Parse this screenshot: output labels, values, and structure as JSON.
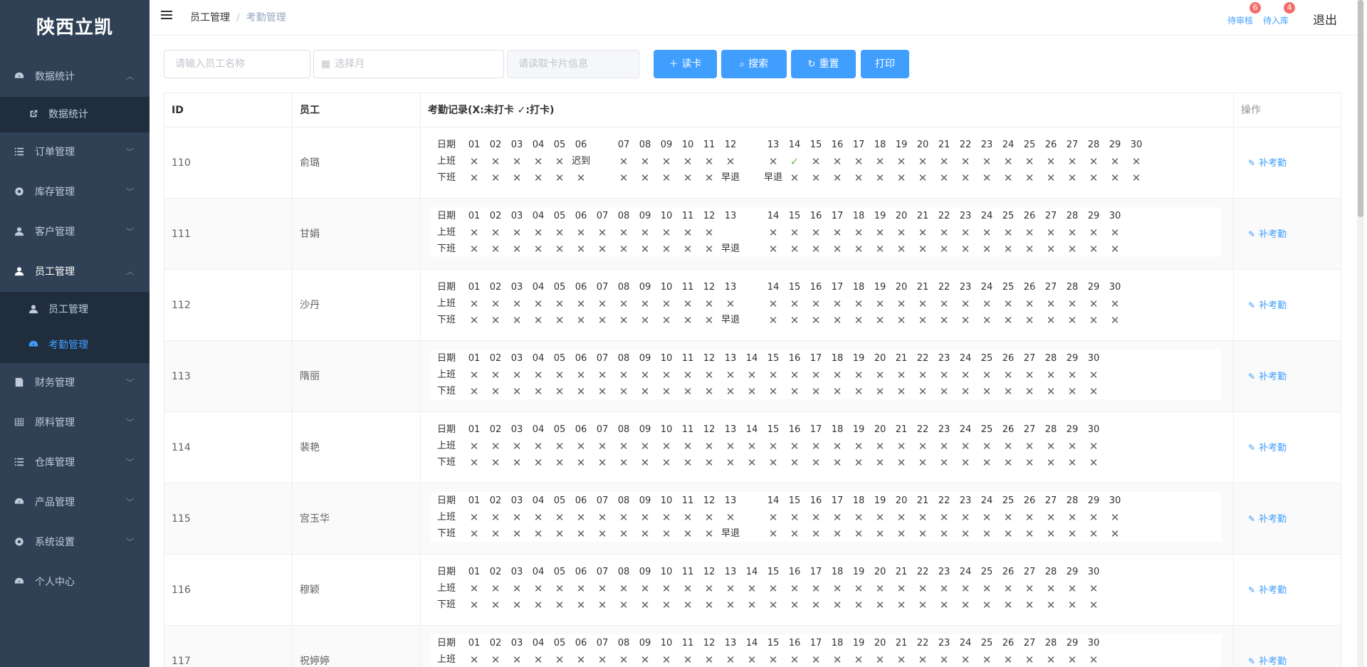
{
  "sidebar": {
    "logo": "陕西立凯",
    "items": [
      {
        "label": "数据统计",
        "icon": "dashboard-icon",
        "arrow": "up"
      },
      {
        "label": "订单管理",
        "icon": "list-icon",
        "arrow": "down"
      },
      {
        "label": "库存管理",
        "icon": "component-icon",
        "arrow": "down"
      },
      {
        "label": "客户管理",
        "icon": "user-icon",
        "arrow": "down"
      },
      {
        "label": "员工管理",
        "icon": "user-icon",
        "arrow": "up"
      },
      {
        "label": "财务管理",
        "icon": "form-icon",
        "arrow": "down"
      },
      {
        "label": "原料管理",
        "icon": "table-icon",
        "arrow": "down"
      },
      {
        "label": "仓库管理",
        "icon": "list-icon",
        "arrow": "down"
      },
      {
        "label": "产品管理",
        "icon": "dashboard-icon",
        "arrow": "down"
      },
      {
        "label": "系统设置",
        "icon": "component-icon",
        "arrow": "down"
      },
      {
        "label": "个人中心",
        "icon": "dashboard-icon",
        "arrow": ""
      }
    ],
    "sub_stats": {
      "label": "数据统计",
      "icon": "external-link-icon"
    },
    "sub_staff": {
      "label": "员工管理",
      "icon": "user-icon"
    },
    "sub_attendance": {
      "label": "考勤管理",
      "icon": "dashboard-icon"
    }
  },
  "navbar": {
    "breadcrumb_home": "员工管理",
    "breadcrumb_sep": "/",
    "breadcrumb_current": "考勤管理",
    "pending_review": {
      "label": "待审核",
      "count": "6"
    },
    "pending_stock": {
      "label": "待入库",
      "count": "4"
    },
    "logout": "退出"
  },
  "filter": {
    "name_placeholder": "请输入员工名称",
    "month_placeholder": "选择月",
    "card_placeholder": "请读取卡片信息",
    "read_card": "读卡",
    "search": "搜索",
    "reset": "重置",
    "print": "打印"
  },
  "table": {
    "headers": {
      "id": "ID",
      "employee": "员工",
      "record": "考勤记录(X:未打卡 ✓:打卡)",
      "action": "操作"
    },
    "row_labels": {
      "date": "日期",
      "on": "上班",
      "off": "下班"
    },
    "action_label": "补考勤",
    "rows": [
      {
        "id": "110",
        "name": "俞璐",
        "days": [
          "01",
          "02",
          "03",
          "04",
          "05",
          "06",
          "",
          "07",
          "08",
          "09",
          "10",
          "11",
          "12",
          "",
          "13",
          "14",
          "15",
          "16",
          "17",
          "18",
          "19",
          "20",
          "21",
          "22",
          "23",
          "24",
          "25",
          "26",
          "27",
          "28",
          "29",
          "30"
        ],
        "on": [
          "✕",
          "✕",
          "✕",
          "✕",
          "✕",
          "迟到",
          "",
          "✕",
          "✕",
          "✕",
          "✕",
          "✕",
          "✕",
          "",
          "✕",
          "✓",
          "✕",
          "✕",
          "✕",
          "✕",
          "✕",
          "✕",
          "✕",
          "✕",
          "✕",
          "✕",
          "✕",
          "✕",
          "✕",
          "✕",
          "✕",
          "✕"
        ],
        "off": [
          "✕",
          "✕",
          "✕",
          "✕",
          "✕",
          "✕",
          "",
          "✕",
          "✕",
          "✕",
          "✕",
          "✕",
          "早退",
          "",
          "早退",
          "✕",
          "✕",
          "✕",
          "✕",
          "✕",
          "✕",
          "✕",
          "✕",
          "✕",
          "✕",
          "✕",
          "✕",
          "✕",
          "✕",
          "✕",
          "✕",
          "✕"
        ]
      },
      {
        "id": "111",
        "name": "甘娟",
        "days": [
          "01",
          "02",
          "03",
          "04",
          "05",
          "06",
          "07",
          "08",
          "09",
          "10",
          "11",
          "12",
          "13",
          "",
          "14",
          "15",
          "16",
          "17",
          "18",
          "19",
          "20",
          "21",
          "22",
          "23",
          "24",
          "25",
          "26",
          "27",
          "28",
          "29",
          "30"
        ],
        "on": [
          "✕",
          "✕",
          "✕",
          "✕",
          "✕",
          "✕",
          "✕",
          "✕",
          "✕",
          "✕",
          "✕",
          "✕",
          "",
          "",
          "✕",
          "✕",
          "✕",
          "✕",
          "✕",
          "✕",
          "✕",
          "✕",
          "✕",
          "✕",
          "✕",
          "✕",
          "✕",
          "✕",
          "✕",
          "✕",
          "✕"
        ],
        "off": [
          "✕",
          "✕",
          "✕",
          "✕",
          "✕",
          "✕",
          "✕",
          "✕",
          "✕",
          "✕",
          "✕",
          "✕",
          "早退",
          "",
          "✕",
          "✕",
          "✕",
          "✕",
          "✕",
          "✕",
          "✕",
          "✕",
          "✕",
          "✕",
          "✕",
          "✕",
          "✕",
          "✕",
          "✕",
          "✕",
          "✕"
        ]
      },
      {
        "id": "112",
        "name": "沙丹",
        "days": [
          "01",
          "02",
          "03",
          "04",
          "05",
          "06",
          "07",
          "08",
          "09",
          "10",
          "11",
          "12",
          "13",
          "",
          "14",
          "15",
          "16",
          "17",
          "18",
          "19",
          "20",
          "21",
          "22",
          "23",
          "24",
          "25",
          "26",
          "27",
          "28",
          "29",
          "30"
        ],
        "on": [
          "✕",
          "✕",
          "✕",
          "✕",
          "✕",
          "✕",
          "✕",
          "✕",
          "✕",
          "✕",
          "✕",
          "✕",
          "✕",
          "",
          "✕",
          "✕",
          "✕",
          "✕",
          "✕",
          "✕",
          "✕",
          "✕",
          "✕",
          "✕",
          "✕",
          "✕",
          "✕",
          "✕",
          "✕",
          "✕",
          "✕"
        ],
        "off": [
          "✕",
          "✕",
          "✕",
          "✕",
          "✕",
          "✕",
          "✕",
          "✕",
          "✕",
          "✕",
          "✕",
          "✕",
          "早退",
          "",
          "✕",
          "✕",
          "✕",
          "✕",
          "✕",
          "✕",
          "✕",
          "✕",
          "✕",
          "✕",
          "✕",
          "✕",
          "✕",
          "✕",
          "✕",
          "✕",
          "✕"
        ]
      },
      {
        "id": "113",
        "name": "隋丽",
        "days": [
          "01",
          "02",
          "03",
          "04",
          "05",
          "06",
          "07",
          "08",
          "09",
          "10",
          "11",
          "12",
          "13",
          "14",
          "15",
          "16",
          "17",
          "18",
          "19",
          "20",
          "21",
          "22",
          "23",
          "24",
          "25",
          "26",
          "27",
          "28",
          "29",
          "30"
        ],
        "on": [
          "✕",
          "✕",
          "✕",
          "✕",
          "✕",
          "✕",
          "✕",
          "✕",
          "✕",
          "✕",
          "✕",
          "✕",
          "✕",
          "✕",
          "✕",
          "✕",
          "✕",
          "✕",
          "✕",
          "✕",
          "✕",
          "✕",
          "✕",
          "✕",
          "✕",
          "✕",
          "✕",
          "✕",
          "✕",
          "✕"
        ],
        "off": [
          "✕",
          "✕",
          "✕",
          "✕",
          "✕",
          "✕",
          "✕",
          "✕",
          "✕",
          "✕",
          "✕",
          "✕",
          "✕",
          "✕",
          "✕",
          "✕",
          "✕",
          "✕",
          "✕",
          "✕",
          "✕",
          "✕",
          "✕",
          "✕",
          "✕",
          "✕",
          "✕",
          "✕",
          "✕",
          "✕"
        ]
      },
      {
        "id": "114",
        "name": "裴艳",
        "days": [
          "01",
          "02",
          "03",
          "04",
          "05",
          "06",
          "07",
          "08",
          "09",
          "10",
          "11",
          "12",
          "13",
          "14",
          "15",
          "16",
          "17",
          "18",
          "19",
          "20",
          "21",
          "22",
          "23",
          "24",
          "25",
          "26",
          "27",
          "28",
          "29",
          "30"
        ],
        "on": [
          "✕",
          "✕",
          "✕",
          "✕",
          "✕",
          "✕",
          "✕",
          "✕",
          "✕",
          "✕",
          "✕",
          "✕",
          "✕",
          "✕",
          "✕",
          "✕",
          "✕",
          "✕",
          "✕",
          "✕",
          "✕",
          "✕",
          "✕",
          "✕",
          "✕",
          "✕",
          "✕",
          "✕",
          "✕",
          "✕"
        ],
        "off": [
          "✕",
          "✕",
          "✕",
          "✕",
          "✕",
          "✕",
          "✕",
          "✕",
          "✕",
          "✕",
          "✕",
          "✕",
          "✕",
          "✕",
          "✕",
          "✕",
          "✕",
          "✕",
          "✕",
          "✕",
          "✕",
          "✕",
          "✕",
          "✕",
          "✕",
          "✕",
          "✕",
          "✕",
          "✕",
          "✕"
        ]
      },
      {
        "id": "115",
        "name": "宫玉华",
        "days": [
          "01",
          "02",
          "03",
          "04",
          "05",
          "06",
          "07",
          "08",
          "09",
          "10",
          "11",
          "12",
          "13",
          "",
          "14",
          "15",
          "16",
          "17",
          "18",
          "19",
          "20",
          "21",
          "22",
          "23",
          "24",
          "25",
          "26",
          "27",
          "28",
          "29",
          "30"
        ],
        "on": [
          "✕",
          "✕",
          "✕",
          "✕",
          "✕",
          "✕",
          "✕",
          "✕",
          "✕",
          "✕",
          "✕",
          "✕",
          "✕",
          "",
          "✕",
          "✕",
          "✕",
          "✕",
          "✕",
          "✕",
          "✕",
          "✕",
          "✕",
          "✕",
          "✕",
          "✕",
          "✕",
          "✕",
          "✕",
          "✕",
          "✕"
        ],
        "off": [
          "✕",
          "✕",
          "✕",
          "✕",
          "✕",
          "✕",
          "✕",
          "✕",
          "✕",
          "✕",
          "✕",
          "✕",
          "早退",
          "",
          "✕",
          "✕",
          "✕",
          "✕",
          "✕",
          "✕",
          "✕",
          "✕",
          "✕",
          "✕",
          "✕",
          "✕",
          "✕",
          "✕",
          "✕",
          "✕",
          "✕"
        ]
      },
      {
        "id": "116",
        "name": "穆颖",
        "days": [
          "01",
          "02",
          "03",
          "04",
          "05",
          "06",
          "07",
          "08",
          "09",
          "10",
          "11",
          "12",
          "13",
          "14",
          "15",
          "16",
          "17",
          "18",
          "19",
          "20",
          "21",
          "22",
          "23",
          "24",
          "25",
          "26",
          "27",
          "28",
          "29",
          "30"
        ],
        "on": [
          "✕",
          "✕",
          "✕",
          "✕",
          "✕",
          "✕",
          "✕",
          "✕",
          "✕",
          "✕",
          "✕",
          "✕",
          "✕",
          "✕",
          "✕",
          "✕",
          "✕",
          "✕",
          "✕",
          "✕",
          "✕",
          "✕",
          "✕",
          "✕",
          "✕",
          "✕",
          "✕",
          "✕",
          "✕",
          "✕"
        ],
        "off": [
          "✕",
          "✕",
          "✕",
          "✕",
          "✕",
          "✕",
          "✕",
          "✕",
          "✕",
          "✕",
          "✕",
          "✕",
          "✕",
          "✕",
          "✕",
          "✕",
          "✕",
          "✕",
          "✕",
          "✕",
          "✕",
          "✕",
          "✕",
          "✕",
          "✕",
          "✕",
          "✕",
          "✕",
          "✕",
          "✕"
        ]
      },
      {
        "id": "117",
        "name": "祝婷婷",
        "days": [
          "01",
          "02",
          "03",
          "04",
          "05",
          "06",
          "07",
          "08",
          "09",
          "10",
          "11",
          "12",
          "13",
          "14",
          "15",
          "16",
          "17",
          "18",
          "19",
          "20",
          "21",
          "22",
          "23",
          "24",
          "25",
          "26",
          "27",
          "28",
          "29",
          "30"
        ],
        "on": [
          "✕",
          "✕",
          "✕",
          "✕",
          "✕",
          "✕",
          "✕",
          "✕",
          "✕",
          "✕",
          "✕",
          "✕",
          "✕",
          "✕",
          "✕",
          "✕",
          "✕",
          "✕",
          "✕",
          "✕",
          "✕",
          "✕",
          "✕",
          "✕",
          "✕",
          "✕",
          "✕",
          "✕",
          "✕",
          "✕"
        ],
        "off": [
          "✕",
          "✕",
          "✕",
          "✕",
          "✕",
          "✕",
          "✕",
          "✕",
          "✕",
          "✕",
          "✕",
          "✕",
          "✕",
          "✕",
          "✕",
          "✕",
          "✕",
          "✕",
          "✕",
          "✕",
          "✕",
          "✕",
          "✕",
          "✕",
          "✕",
          "✕",
          "✕",
          "✕",
          "✕",
          "✕"
        ]
      }
    ]
  }
}
